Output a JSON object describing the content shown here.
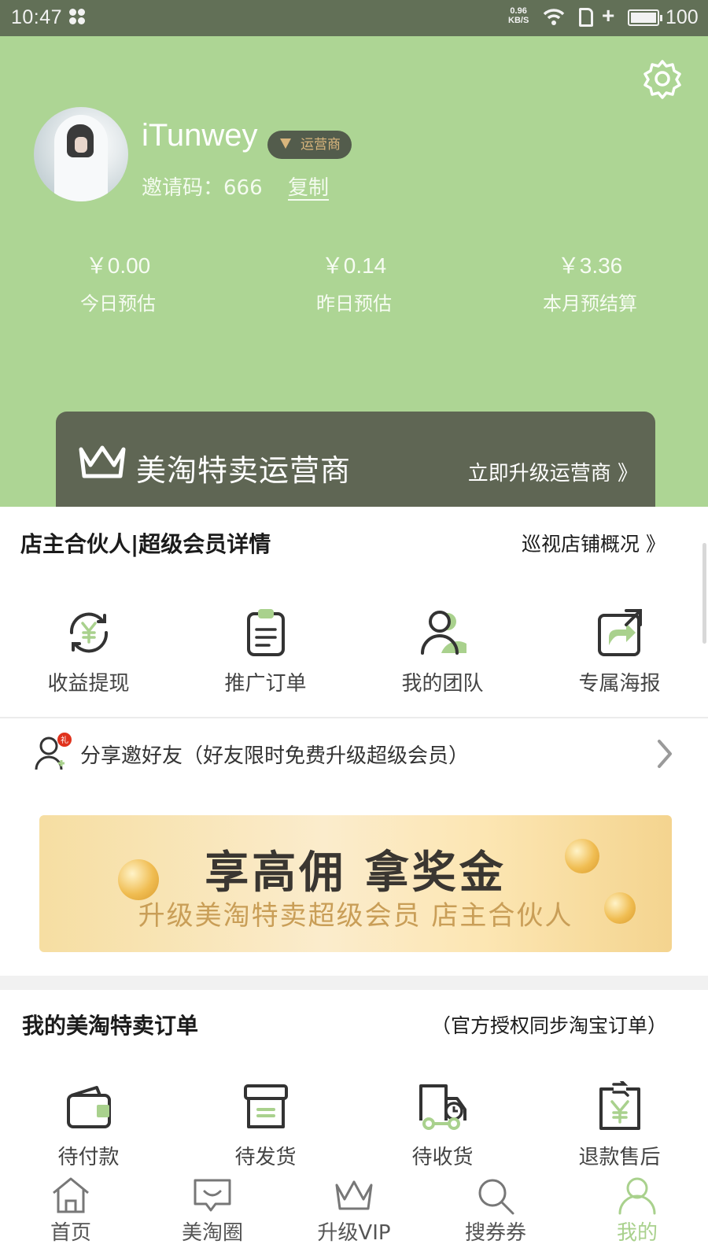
{
  "status_bar": {
    "time": "10:47",
    "net_speed_value": "0.96",
    "net_speed_unit": "KB/S",
    "battery": "100",
    "icons": [
      "apps-icon",
      "wifi-icon",
      "sim-icon",
      "plus-icon",
      "battery-icon"
    ]
  },
  "profile": {
    "username": "iTunwey",
    "role_badge": "运营商",
    "invite_label": "邀请码：666",
    "copy_label": "复制"
  },
  "earnings": [
    {
      "amount": "￥0.00",
      "label": "今日预估"
    },
    {
      "amount": "￥0.14",
      "label": "昨日预估"
    },
    {
      "amount": "￥3.36",
      "label": "本月预结算"
    }
  ],
  "vip_card": {
    "title": "美淘特卖运营商",
    "cta": "立即升级运营商 》"
  },
  "partner_section": {
    "title": "店主合伙人|超级会员详情",
    "link": "巡视店铺概况 》",
    "items": [
      {
        "label": "收益提现",
        "icon": "withdraw-icon"
      },
      {
        "label": "推广订单",
        "icon": "clipboard-icon"
      },
      {
        "label": "我的团队",
        "icon": "team-icon"
      },
      {
        "label": "专属海报",
        "icon": "share-poster-icon"
      }
    ]
  },
  "share_row": {
    "text": "分享邀好友（好友限时免费升级超级会员）",
    "badge": "礼"
  },
  "banner": {
    "headline": "享高佣 拿奖金",
    "subline": "升级美淘特卖超级会员 店主合伙人"
  },
  "orders_section": {
    "title": "我的美淘特卖订单",
    "note": "（官方授权同步淘宝订单）",
    "items": [
      {
        "label": "待付款",
        "icon": "wallet-icon"
      },
      {
        "label": "待发货",
        "icon": "box-icon"
      },
      {
        "label": "待收货",
        "icon": "truck-icon"
      },
      {
        "label": "退款售后",
        "icon": "refund-icon"
      }
    ]
  },
  "tabbar": [
    {
      "label": "首页",
      "icon": "home-icon"
    },
    {
      "label": "美淘圈",
      "icon": "chat-icon"
    },
    {
      "label": "升级VIP",
      "icon": "crown-icon"
    },
    {
      "label": "搜券券",
      "icon": "search-icon"
    },
    {
      "label": "我的",
      "icon": "user-icon",
      "active": true
    }
  ],
  "colors": {
    "header_green": "#add594",
    "status_bar": "#627057",
    "vip_card": "#5f6654",
    "accent_green": "#a9d18d",
    "badge_gold": "#d8b57c"
  }
}
